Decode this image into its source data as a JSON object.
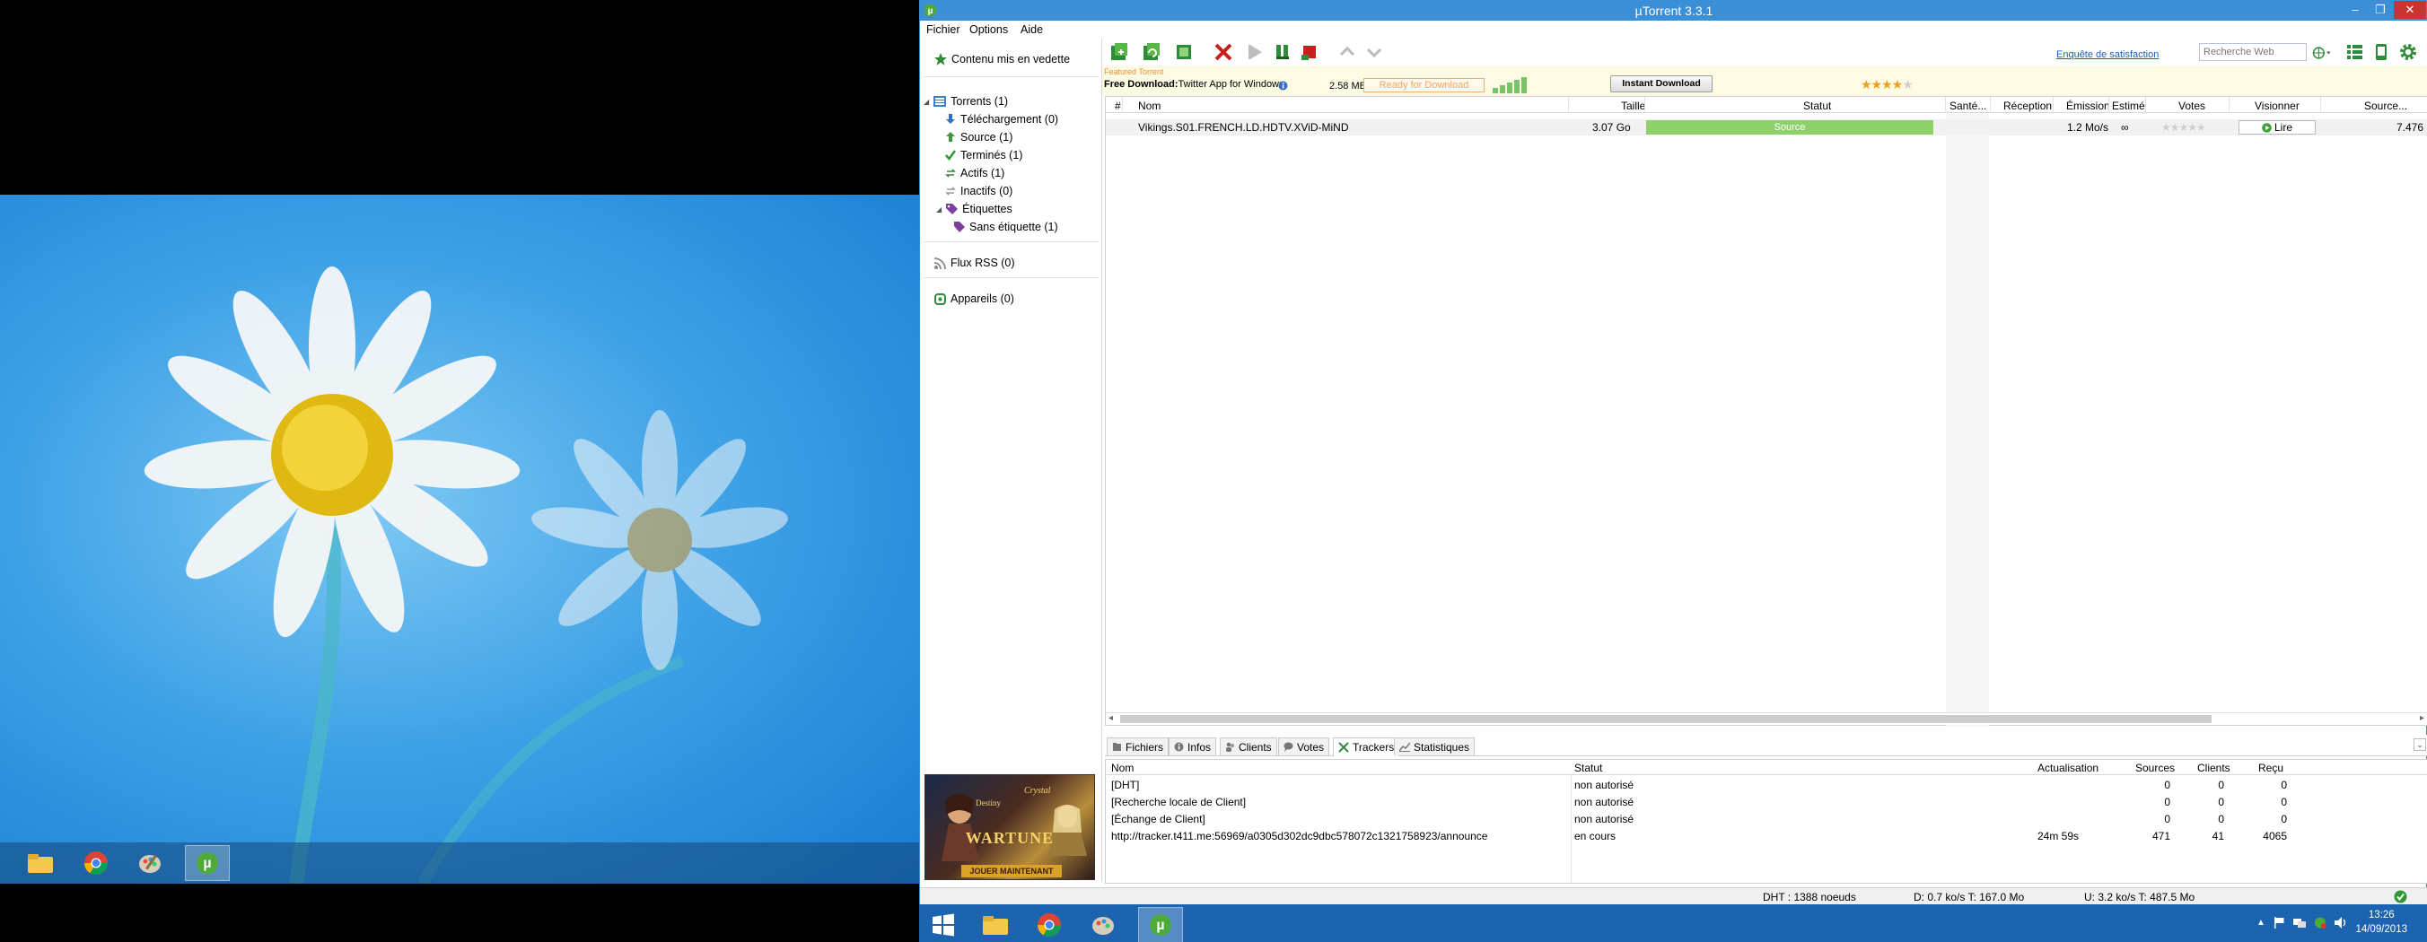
{
  "window": {
    "title": "µTorrent 3.3.1",
    "controls": [
      "–",
      "❐",
      "✕"
    ]
  },
  "menu": [
    "Fichier",
    "Options",
    "Aide"
  ],
  "sidebar": {
    "featured": "Contenu mis en vedette",
    "torrents": "Torrents (1)",
    "downloading": "Téléchargement (0)",
    "seeding": "Source (1)",
    "completed": "Terminés (1)",
    "active": "Actifs (1)",
    "inactive": "Inactifs (0)",
    "labels": "Étiquettes",
    "no_label": "Sans étiquette (1)",
    "rss": "Flux RSS (0)",
    "devices": "Appareils (0)",
    "ad": {
      "brand1": "Crystal",
      "brand2": "Destiny",
      "game": "WARTUNE",
      "cta": "JOUER MAINTENANT"
    }
  },
  "toolbar": {
    "feedback": "Enquête de satisfaction",
    "search_placeholder": "Recherche Web"
  },
  "featured_bar": {
    "tag": "Featured Torrent",
    "prefix": "Free Download:",
    "title": "Twitter App for Windows",
    "size": "2.58 MB",
    "ready": "Ready for Download",
    "button": "Instant Download",
    "rating": 4,
    "rating_max": 5
  },
  "torrent_list": {
    "headers": [
      "#",
      "Nom",
      "Taille",
      "Statut",
      "Santé...",
      "Réception",
      "Émission",
      "Estimé",
      "Votes",
      "Visionner",
      "Source..."
    ],
    "rows": [
      {
        "name": "Vikings.S01.FRENCH.LD.HDTV.XViD-MiND",
        "size": "3.07 Go",
        "status": "Source",
        "upload": "1.2 Mo/s",
        "eta": "∞",
        "watch": "Lire",
        "seeds": "7.476",
        "rating": 0,
        "rating_max": 5
      }
    ]
  },
  "tabs": [
    "Fichiers",
    "Infos",
    "Clients",
    "Votes",
    "Trackers",
    "Statistiques"
  ],
  "active_tab": "Trackers",
  "trackers": {
    "headers": [
      "Nom",
      "Statut",
      "Actualisation",
      "Sources",
      "Clients",
      "Reçu"
    ],
    "rows": [
      {
        "name": "[DHT]",
        "status": "non autorisé",
        "update": "",
        "seeds": "0",
        "peers": "0",
        "received": "0"
      },
      {
        "name": "[Recherche locale de Client]",
        "status": "non autorisé",
        "update": "",
        "seeds": "0",
        "peers": "0",
        "received": "0"
      },
      {
        "name": "[Échange de Client]",
        "status": "non autorisé",
        "update": "",
        "seeds": "0",
        "peers": "0",
        "received": "0"
      },
      {
        "name": "http://tracker.t411.me:56969/a0305d302dc9dbc578072c1321758923/announce",
        "status": "en cours",
        "update": "24m 59s",
        "seeds": "471",
        "peers": "41",
        "received": "4065"
      }
    ]
  },
  "statusbar": {
    "dht": "DHT : 1388 noeuds",
    "download": "D: 0.7 ko/s T: 167.0 Mo",
    "upload": "U: 3.2 ko/s T: 487.5 Mo"
  },
  "clock": {
    "time": "13:26",
    "date": "14/09/2013"
  },
  "colors": {
    "titlebar": "#3b8fd6",
    "seeding_bar": "#8ed06a",
    "taskbar": "#1c63b0",
    "accent_green": "#1f8f2f"
  }
}
